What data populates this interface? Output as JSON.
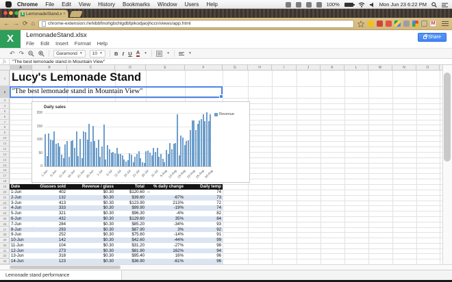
{
  "macos_menu_bar": {
    "items": [
      "Chrome",
      "File",
      "Edit",
      "View",
      "History",
      "Bookmarks",
      "Window",
      "Users",
      "Help"
    ],
    "battery_percent": "100%",
    "clock": "Mon Jun 23 6:22 PM"
  },
  "browser": {
    "tab_title": "LemonadeStand.xlsx",
    "url": "chrome-extension://ehibbfinohgbchlgdbfpikodjaojhccn/views/app.html",
    "extension_icon_names": [
      "bookmark-star-icon",
      "yellow-extension-icon",
      "red-extension-icon",
      "orange-extension-icon",
      "drive-extension-icon",
      "gray-extension-icon",
      "multicolor-extension-icon",
      "frame-extension-icon",
      "gmail-extension-icon"
    ],
    "extension_icon_colors": [
      "none",
      "#f4c20d",
      "#cf4437",
      "#e25241",
      "#3aa757",
      "#9e9e9e",
      "#4285f4",
      "#8a8a8a",
      "#d93025"
    ]
  },
  "app": {
    "logo_letter": "X",
    "title": "LemonadeStand.xlsx",
    "menus": [
      "File",
      "Edit",
      "Insert",
      "Format",
      "Help"
    ],
    "share_label": "Share",
    "toolbar": {
      "undo": "↶",
      "redo": "↷",
      "font_name": "Garamond",
      "font_size": "10",
      "bold": "B",
      "italic": "I",
      "underline": "U",
      "text_color": "A"
    },
    "formula_bar": {
      "fx_label": "fx",
      "value": "\"The best lemonade stand in Mountain View\""
    }
  },
  "grid": {
    "columns": [
      "A",
      "B",
      "C",
      "D",
      "E",
      "F",
      "G",
      "H",
      "I",
      "J",
      "K",
      "L",
      "M",
      "N",
      "O"
    ],
    "selected_column": "A",
    "selected_row": 2,
    "visible_row_range": [
      1,
      33
    ],
    "cell_a1": "Lucy's Lemonade Stand",
    "cell_a2": "\"The best lemonade stand in Mountain View\""
  },
  "table": {
    "header_row_number": 19,
    "first_data_row_number": 20,
    "headers": [
      "Date",
      "Glasses sold",
      "Revenue / glass",
      "Total",
      "% daily change",
      "Daily temp"
    ],
    "rows": [
      [
        "1-Jun",
        "402",
        "$0.30",
        "$120.60",
        "--",
        "74"
      ],
      [
        "2-Jun",
        "132",
        "$0.30",
        "$39.60",
        "-67%",
        "73"
      ],
      [
        "3-Jun",
        "413",
        "$0.30",
        "$123.90",
        "213%",
        "72"
      ],
      [
        "4-Jun",
        "333",
        "$0.30",
        "$99.90",
        "-19%",
        "74"
      ],
      [
        "5-Jun",
        "321",
        "$0.30",
        "$96.30",
        "-4%",
        "82"
      ],
      [
        "6-Jun",
        "432",
        "$0.30",
        "$129.60",
        "35%",
        "84"
      ],
      [
        "7-Jun",
        "284",
        "$0.30",
        "$85.20",
        "-34%",
        "93"
      ],
      [
        "8-Jun",
        "293",
        "$0.30",
        "$87.90",
        "3%",
        "92"
      ],
      [
        "9-Jun",
        "252",
        "$0.30",
        "$75.60",
        "-14%",
        "91"
      ],
      [
        "10-Jun",
        "142",
        "$0.30",
        "$42.60",
        "-44%",
        "99"
      ],
      [
        "11-Jun",
        "104",
        "$0.30",
        "$31.20",
        "-27%",
        "98"
      ],
      [
        "12-Jun",
        "273",
        "$0.30",
        "$81.90",
        "162%",
        "94"
      ],
      [
        "13-Jun",
        "318",
        "$0.30",
        "$95.40",
        "16%",
        "96"
      ],
      [
        "14-Jun",
        "123",
        "$0.30",
        "$36.90",
        "-61%",
        "96"
      ]
    ]
  },
  "chart_data": {
    "type": "bar",
    "title": "Daily sales",
    "legend": [
      "Revenue"
    ],
    "legend_position": "right",
    "grid": true,
    "ylim": [
      0,
      200
    ],
    "yticks": [
      0,
      50,
      100,
      150,
      200
    ],
    "x_tick_labels": [
      "1-Jun",
      "6-Jun",
      "11-Jun",
      "16-Jun",
      "21-Jun",
      "26-Jun",
      "1-Jul",
      "6-Jul",
      "11-Jul",
      "16-Jul",
      "21-Jul",
      "26-Jul",
      "31-Jul",
      "5-Aug",
      "10-Aug",
      "15-Aug",
      "20-Aug",
      "25-Aug",
      "30-Aug"
    ],
    "series": [
      {
        "name": "Revenue",
        "values": [
          120.6,
          39.6,
          123.9,
          99.9,
          96.3,
          129.6,
          85.2,
          87.9,
          75.6,
          42.6,
          31.2,
          81.9,
          95.4,
          36.9,
          94,
          97,
          70,
          130,
          39,
          102,
          31,
          130,
          128,
          101,
          158,
          92,
          151,
          96,
          69,
          101,
          37,
          75,
          157,
          25,
          80,
          63,
          52,
          55,
          48,
          70,
          45,
          47,
          42,
          25,
          18,
          22,
          50,
          43,
          15,
          35,
          45,
          57,
          30,
          15,
          12,
          57,
          60,
          52,
          42,
          70,
          55,
          68,
          35,
          45,
          28,
          15,
          62,
          47,
          88,
          65,
          85,
          88,
          195,
          42,
          115,
          108,
          80,
          95,
          97,
          135,
          172,
          172,
          135,
          158,
          172,
          178,
          195,
          170,
          202,
          170,
          195
        ]
      }
    ],
    "colors": {
      "bar_fill": "#a5c4e6",
      "bar_edge": "#6d9dca"
    }
  },
  "sheet_tabs": [
    {
      "label": "Lemonade stand performance",
      "active": true
    }
  ],
  "colors": {
    "chrome_frame_tan": "#d2b87e",
    "sheets_green": "#2e9e5b",
    "share_blue": "#4285f4",
    "selection_blue": "#4a86e8",
    "table_band_blue": "#dbe5f1",
    "table_header_black": "#151515"
  }
}
